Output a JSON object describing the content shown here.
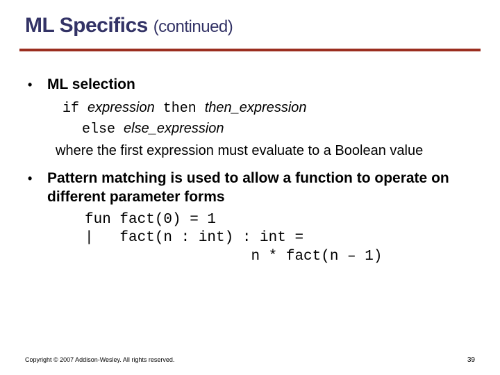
{
  "title": {
    "main": "ML Specifics ",
    "cont": "(continued)"
  },
  "bullets": {
    "b1": "ML selection",
    "b1_line1_kw_if": "if ",
    "b1_line1_expr": "expression",
    "b1_line1_kw_then": " then ",
    "b1_line1_thenexpr": "then_expression",
    "b1_line2_kw_else": "else ",
    "b1_line2_elseexpr": "else_expression",
    "b1_note": "where the first expression must evaluate to a Boolean value",
    "b2": "Pattern matching is used to allow a function to operate on different parameter forms",
    "code_l1": "fun fact(0) = 1",
    "code_l2": "|   fact(n : int) : int =",
    "code_l3": "                   n * fact(n – 1)"
  },
  "footer": {
    "copyright": "Copyright © 2007 Addison-Wesley. All rights reserved.",
    "page": "39"
  }
}
